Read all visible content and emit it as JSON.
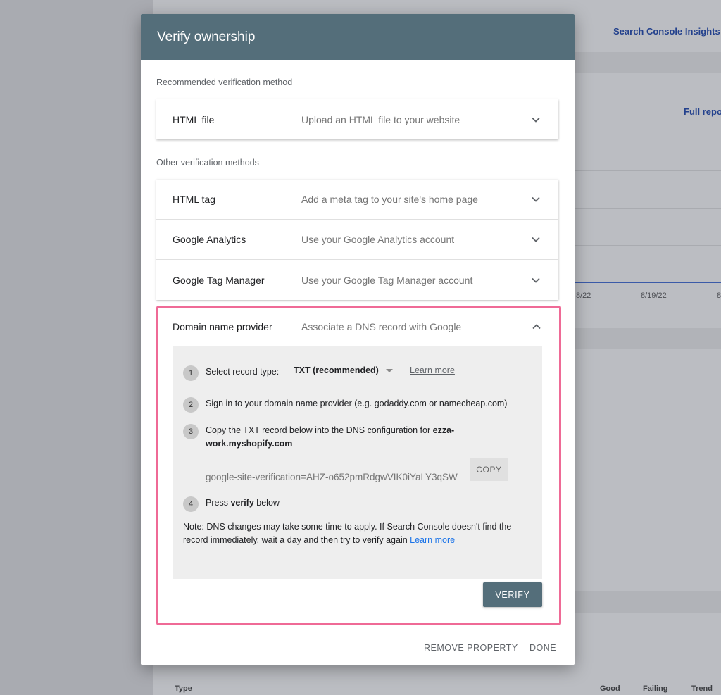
{
  "background": {
    "insights_link": "Search Console Insights",
    "full_report_link": "Full repo",
    "axis_ticks": [
      "8/22",
      "8/19/22",
      "8"
    ],
    "table_columns": {
      "type": "Type",
      "good": "Good",
      "failing": "Failing",
      "trend": "Trend"
    }
  },
  "dialog": {
    "title": "Verify ownership",
    "recommended_label": "Recommended verification method",
    "other_label": "Other verification methods",
    "recommended": [
      {
        "name": "HTML file",
        "desc": "Upload an HTML file to your website"
      }
    ],
    "other": [
      {
        "name": "HTML tag",
        "desc": "Add a meta tag to your site's home page"
      },
      {
        "name": "Google Analytics",
        "desc": "Use your Google Analytics account"
      },
      {
        "name": "Google Tag Manager",
        "desc": "Use your Google Tag Manager account"
      }
    ],
    "domain": {
      "name": "Domain name provider",
      "desc": "Associate a DNS record with Google",
      "steps": {
        "s1_num": "1",
        "s1_label": "Select record type:",
        "s1_select": "TXT (recommended)",
        "s1_learn": "Learn more",
        "s2_num": "2",
        "s2_text": "Sign in to your domain name provider (e.g. godaddy.com or namecheap.com)",
        "s3_num": "3",
        "s3_text": "Copy the TXT record below into the DNS configuration for ",
        "s3_domain_a": "ezza-",
        "s3_domain_b": "work.myshopify.com",
        "txt_value": "google-site-verification=AHZ-o652pmRdgwVIK0iYaLY3qSW",
        "copy_label": "COPY",
        "s4_num": "4",
        "s4_pre": "Press ",
        "s4_bold": "verify",
        "s4_post": " below"
      },
      "note": "Note: DNS changes may take some time to apply. If Search Console doesn't find the record immediately, wait a day and then try to verify again ",
      "note_link": "Learn more",
      "verify_label": "VERIFY"
    },
    "footer": {
      "remove_label": "REMOVE PROPERTY",
      "done_label": "DONE"
    }
  },
  "colors": {
    "header": "#546e7a",
    "highlight": "#ef6a96",
    "link": "#1a73e8"
  }
}
